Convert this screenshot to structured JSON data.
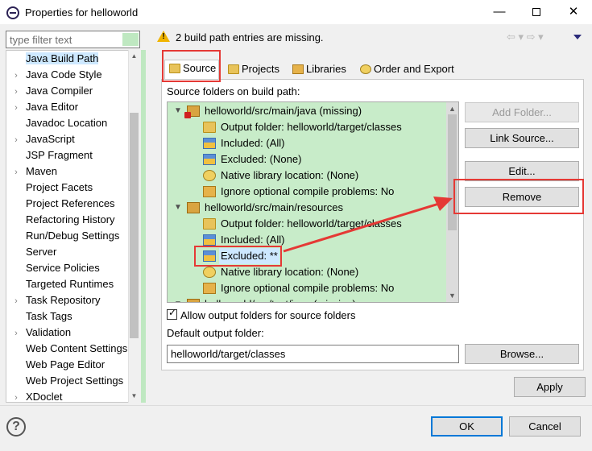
{
  "window": {
    "title": "Properties for helloworld",
    "min_label": "—",
    "close_label": "✕"
  },
  "filter": {
    "placeholder": "type filter text"
  },
  "nav": {
    "items": [
      {
        "label": "Java Build Path",
        "expandable": false,
        "selected": true
      },
      {
        "label": "Java Code Style",
        "expandable": true
      },
      {
        "label": "Java Compiler",
        "expandable": true
      },
      {
        "label": "Java Editor",
        "expandable": true
      },
      {
        "label": "Javadoc Location",
        "expandable": false
      },
      {
        "label": "JavaScript",
        "expandable": true
      },
      {
        "label": "JSP Fragment",
        "expandable": false
      },
      {
        "label": "Maven",
        "expandable": true
      },
      {
        "label": "Project Facets",
        "expandable": false
      },
      {
        "label": "Project References",
        "expandable": false
      },
      {
        "label": "Refactoring History",
        "expandable": false
      },
      {
        "label": "Run/Debug Settings",
        "expandable": false
      },
      {
        "label": "Server",
        "expandable": false
      },
      {
        "label": "Service Policies",
        "expandable": false
      },
      {
        "label": "Targeted Runtimes",
        "expandable": false
      },
      {
        "label": "Task Repository",
        "expandable": true
      },
      {
        "label": "Task Tags",
        "expandable": false
      },
      {
        "label": "Validation",
        "expandable": true
      },
      {
        "label": "Web Content Settings",
        "expandable": false
      },
      {
        "label": "Web Page Editor",
        "expandable": false
      },
      {
        "label": "Web Project Settings",
        "expandable": false
      },
      {
        "label": "XDoclet",
        "expandable": true
      }
    ]
  },
  "header": {
    "message": "2 build path entries are missing.",
    "nav_arrows": "⇦ ▾ ⇨ ▾"
  },
  "tabs": [
    {
      "label": "Source",
      "active": true
    },
    {
      "label": "Projects"
    },
    {
      "label": "Libraries"
    },
    {
      "label": "Order and Export"
    }
  ],
  "source": {
    "label": "Source folders on build path:",
    "tree": [
      {
        "label": "helloworld/src/main/java (missing)",
        "level": 0,
        "icon": "package-error-icon"
      },
      {
        "label": "Output folder: helloworld/target/classes",
        "level": 1,
        "icon": "output-folder-icon"
      },
      {
        "label": "Included: (All)",
        "level": 1,
        "icon": "inclusion-filter-icon"
      },
      {
        "label": "Excluded: (None)",
        "level": 1,
        "icon": "exclusion-filter-icon"
      },
      {
        "label": "Native library location: (None)",
        "level": 1,
        "icon": "native-library-icon"
      },
      {
        "label": "Ignore optional compile problems: No",
        "level": 1,
        "icon": "ignore-problems-icon"
      },
      {
        "label": "helloworld/src/main/resources",
        "level": 0,
        "icon": "package-folder-icon"
      },
      {
        "label": "Output folder: helloworld/target/classes",
        "level": 1,
        "icon": "output-folder-icon"
      },
      {
        "label": "Included: (All)",
        "level": 1,
        "icon": "inclusion-filter-icon"
      },
      {
        "label": "Excluded: **",
        "level": 1,
        "icon": "exclusion-filter-icon",
        "selected": true
      },
      {
        "label": "Native library location: (None)",
        "level": 1,
        "icon": "native-library-icon"
      },
      {
        "label": "Ignore optional compile problems: No",
        "level": 1,
        "icon": "ignore-problems-icon"
      },
      {
        "label": "helloworld/src/test/java (missing)",
        "level": 0,
        "icon": "package-error-icon"
      }
    ],
    "buttons": {
      "add_folder": "Add Folder...",
      "link_source": "Link Source...",
      "edit": "Edit...",
      "remove": "Remove"
    },
    "allow_output_label": "Allow output folders for source folders",
    "allow_output_checked": true,
    "default_output_label": "Default output folder:",
    "default_output_value": "helloworld/target/classes",
    "browse": "Browse..."
  },
  "footer": {
    "apply": "Apply",
    "ok": "OK",
    "cancel": "Cancel",
    "help": "?"
  },
  "colors": {
    "annotation_red": "#e53935",
    "tree_bg": "#c8ecc9",
    "selection_bg": "#cde8ff"
  }
}
